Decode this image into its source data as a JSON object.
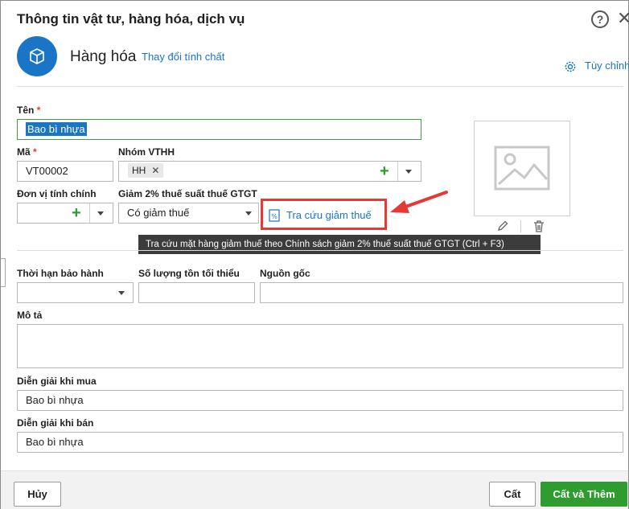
{
  "dialog": {
    "title": "Thông tin vật tư, hàng hóa, dịch vụ",
    "help_label": "?",
    "close_label": "✕"
  },
  "item_type": {
    "label": "Hàng hóa",
    "change_link": "Thay đổi tính chất",
    "icon": "box-icon",
    "color": "#1b75c6"
  },
  "customize_label": "Tùy chỉnh",
  "fields": {
    "name": {
      "label": "Tên",
      "required_mark": "*",
      "value": "Bao bì nhựa"
    },
    "code": {
      "label": "Mã",
      "required_mark": "*",
      "value": "VT00002"
    },
    "group": {
      "label": "Nhóm VTHH",
      "tag": "HH",
      "tag_remove": "✕"
    },
    "unit": {
      "label": "Đơn vị tính chính",
      "value": ""
    },
    "tax_reduction": {
      "label": "Giảm 2% thuế suất thuế GTGT",
      "value": "Có giảm thuế"
    },
    "warranty": {
      "label": "Thời hạn bảo hành",
      "value": ""
    },
    "min_stock": {
      "label": "Số lượng tồn tối thiểu",
      "value": ""
    },
    "origin": {
      "label": "Nguồn gốc",
      "value": ""
    },
    "description": {
      "label": "Mô tả",
      "value": ""
    },
    "purchase_desc": {
      "label": "Diễn giải khi mua",
      "value": "Bao bì nhựa"
    },
    "sale_desc": {
      "label": "Diễn giải khi bán",
      "value": "Bao bì nhựa"
    }
  },
  "lookup": {
    "label": "Tra cứu giảm thuế",
    "tooltip": "Tra cứu mặt hàng giảm thuế theo Chính sách giảm 2% thuế suất thuế GTGT (Ctrl + F3)",
    "highlight_color": "#e53935"
  },
  "footer": {
    "cancel": "Hủy",
    "save": "Cất",
    "save_add": "Cất và Thêm"
  },
  "colors": {
    "accent": "#1b75c6",
    "primary_button": "#2e9c2e",
    "required": "#e53935"
  }
}
